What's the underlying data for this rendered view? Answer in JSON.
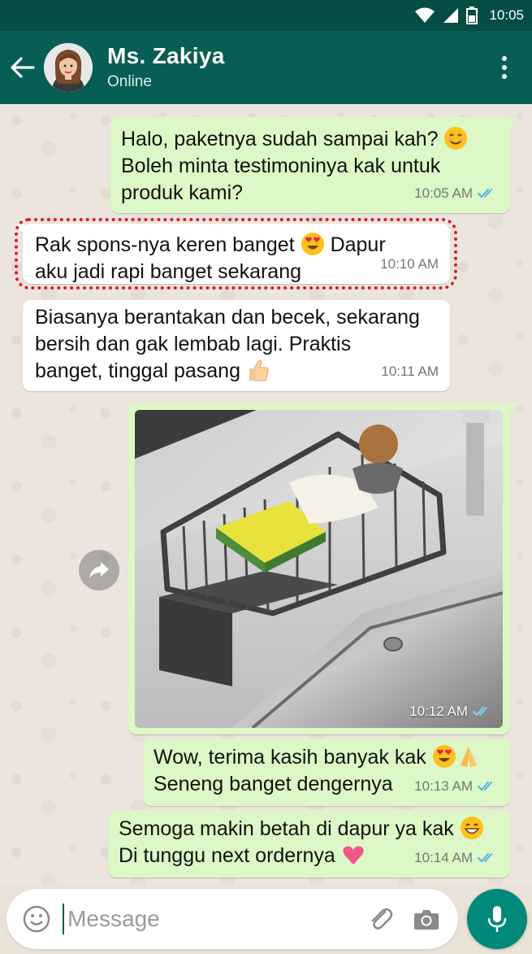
{
  "status_bar": {
    "time": "10:05"
  },
  "header": {
    "contact_name": "Ms. Zakiya",
    "contact_status": "Online"
  },
  "messages": [
    {
      "direction": "out",
      "lines": [
        "Halo, paketnya sudah sampai kah?",
        "Boleh minta testimoninya kak untuk",
        "produk kami?"
      ],
      "emojis": [
        "smiling-face-emoji"
      ],
      "time": "10:05 AM",
      "status": "read"
    },
    {
      "direction": "in",
      "lines": [
        "Rak spons-nya keren banget",
        "Dapur",
        "aku jadi rapi banget sekarang"
      ],
      "emojis": [
        "heart-eyes-emoji"
      ],
      "time": "10:10 AM",
      "highlighted": true
    },
    {
      "direction": "in",
      "lines": [
        "Biasanya berantakan dan becek, sekarang",
        "bersih dan gak lembab lagi. Praktis",
        "banget, tinggal pasang"
      ],
      "emojis": [
        "thumbs-up-emoji"
      ],
      "time": "10:11 AM"
    },
    {
      "direction": "out",
      "type": "image",
      "image_alt": "sink-sponge-rack-photo",
      "time": "10:12 AM",
      "status": "read"
    },
    {
      "direction": "out",
      "lines": [
        "Wow, terima kasih banyak kak",
        "Seneng banget dengernya"
      ],
      "emojis": [
        "heart-eyes-emoji",
        "folded-hands-emoji"
      ],
      "time": "10:13 AM",
      "status": "read"
    },
    {
      "direction": "out",
      "lines": [
        "Semoga makin betah di dapur ya kak",
        "Di tunggu next ordernya"
      ],
      "emojis": [
        "grinning-face-emoji",
        "heart-emoji"
      ],
      "time": "10:14 AM",
      "status": "read"
    }
  ],
  "composer": {
    "placeholder": "Message"
  },
  "colors": {
    "header": "#075e54",
    "status_bar": "#054d44",
    "outgoing_bubble": "#dcf8c6",
    "incoming_bubble": "#ffffff",
    "read_ticks": "#34b7f1",
    "mic_button": "#00897b",
    "highlight": "#d81b23"
  }
}
